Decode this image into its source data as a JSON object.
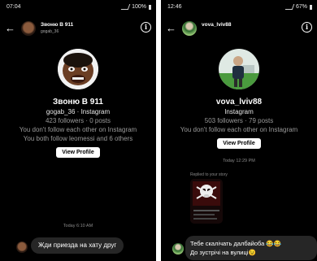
{
  "left": {
    "status": {
      "time": "07:04",
      "battery": "100%"
    },
    "header": {
      "title": "Звоню В 911",
      "subtitle": "gogab_36"
    },
    "profile": {
      "name": "Звоню В 911",
      "handle_line": "gogab_36 · Instagram",
      "stats": "423 followers · 0 posts",
      "follow_note": "You don't follow each other on Instagram",
      "mutual_note": "You both follow leomessi and 6 others",
      "view_profile": "View Profile"
    },
    "timestamp": "Today 6:10 AM",
    "message": "Жди приезда на хату друг"
  },
  "right": {
    "status": {
      "time": "12:46",
      "battery": "67%"
    },
    "header": {
      "title": "vova_lviv88"
    },
    "profile": {
      "name": "vova_lviv88",
      "platform": "Instagram",
      "stats": "503 followers · 79 posts",
      "follow_note": "You don't follow each other on Instagram",
      "view_profile": "View Profile"
    },
    "timestamp": "Today 12:29 PM",
    "reply_label": "Replied to your story",
    "message_line1": "Тебе скалічать далбайоба 😂😂",
    "message_line2": "До зустрічі на вулиці😉"
  },
  "icons": {
    "back": "arrow-left-icon",
    "info": "info-icon",
    "story": "skull-icon"
  },
  "colors": {
    "background": "#000000",
    "bubble": "#262626",
    "button": "#ffffff",
    "muted_text": "#999999"
  }
}
